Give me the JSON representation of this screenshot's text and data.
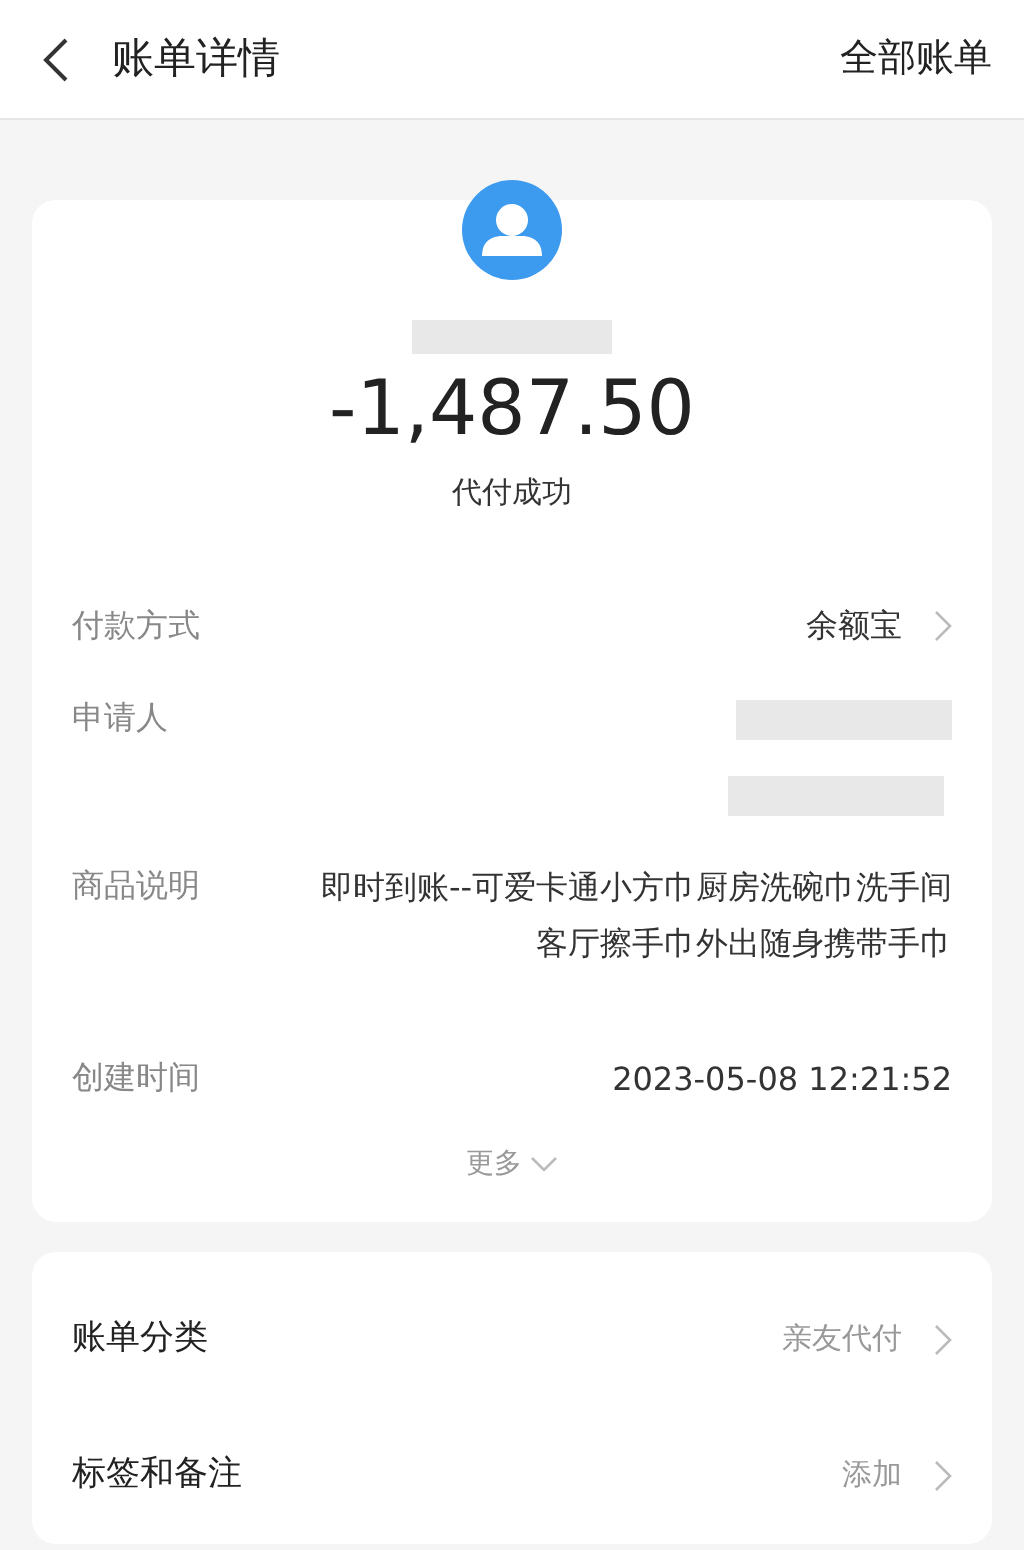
{
  "header": {
    "title": "账单详情",
    "action": "全部账单"
  },
  "summary": {
    "amount": "-1,487.50",
    "status": "代付成功"
  },
  "details": [
    {
      "kind": "link",
      "label": "付款方式",
      "value": "余额宝"
    },
    {
      "kind": "redacted",
      "label": "申请人"
    },
    {
      "kind": "text",
      "label": "商品说明",
      "value": "即时到账--可爱卡通小方巾厨房洗碗巾洗手间客厅擦手巾外出随身携带手巾"
    },
    {
      "kind": "text",
      "label": "创建时间",
      "value": "2023-05-08 12:21:52"
    }
  ],
  "more": {
    "label": "更多",
    "expanded": false
  },
  "options": [
    {
      "label": "账单分类",
      "value": "亲友代付"
    },
    {
      "label": "标签和备注",
      "value": "添加"
    }
  ]
}
